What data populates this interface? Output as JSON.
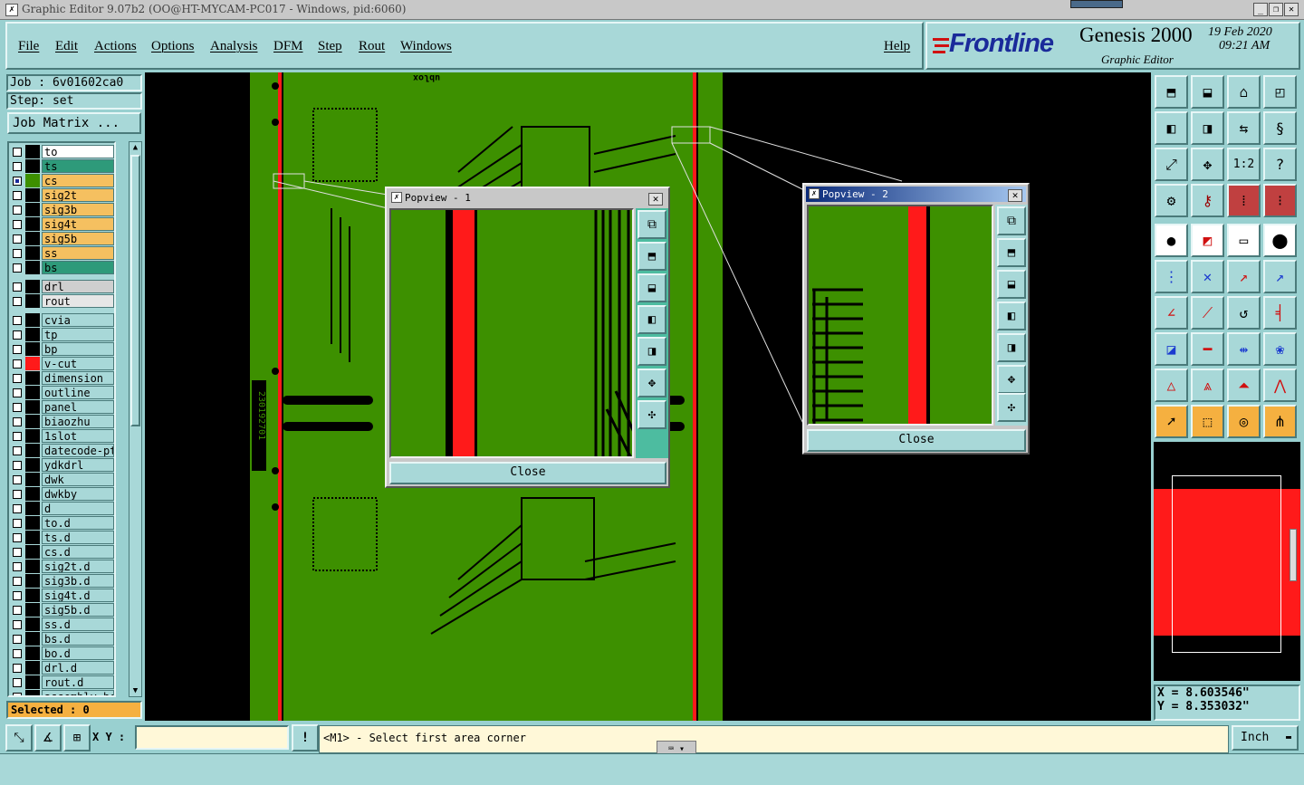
{
  "window": {
    "title": "Graphic Editor 9.07b2 (OO@HT-MYCAM-PC017 - Windows, pid:6060)",
    "minimize": "_",
    "restore": "❐",
    "close": "✕"
  },
  "menu": {
    "items": [
      "File",
      "Edit",
      "Actions",
      "Options",
      "Analysis",
      "DFM",
      "Step",
      "Rout",
      "Windows"
    ],
    "help": "Help"
  },
  "brand": {
    "logo": "Frontline",
    "product": "Genesis 2000",
    "subtitle": "Graphic Editor",
    "date": "19 Feb 2020",
    "time": "09:21 AM"
  },
  "job": {
    "job_label": "Job : 6v01602ca0",
    "step_label": "Step: set",
    "matrix_button": "Job Matrix ..."
  },
  "colors": {
    "yellow": "#f5c060",
    "teal": "#2e9a7a",
    "cyan": "#a8d8d8",
    "grey": "#cfcfcf",
    "white": "#ffffff",
    "board_green": "#3d9000",
    "copper_red": "#ff1a1a"
  },
  "layers": [
    {
      "name": "to",
      "bg": "#ffffff",
      "swatch": "#000000",
      "check": false
    },
    {
      "name": "ts",
      "bg": "#2e9a7a",
      "swatch": "#000000",
      "check": false
    },
    {
      "name": "cs",
      "bg": "#f5c060",
      "swatch": "#3d9000",
      "check": true
    },
    {
      "name": "sig2t",
      "bg": "#f5c060",
      "swatch": "#000000",
      "check": false
    },
    {
      "name": "sig3b",
      "bg": "#f5c060",
      "swatch": "#000000",
      "check": false
    },
    {
      "name": "sig4t",
      "bg": "#f5c060",
      "swatch": "#000000",
      "check": false
    },
    {
      "name": "sig5b",
      "bg": "#f5c060",
      "swatch": "#000000",
      "check": false
    },
    {
      "name": "ss",
      "bg": "#f5c060",
      "swatch": "#000000",
      "check": false
    },
    {
      "name": "bs",
      "bg": "#2e9a7a",
      "swatch": "#000000",
      "check": false
    },
    {
      "name": "drl",
      "bg": "#cfcfcf",
      "swatch": "#000000",
      "check": false,
      "gap": true
    },
    {
      "name": "rout",
      "bg": "#e6e6e6",
      "swatch": "#000000",
      "check": false
    },
    {
      "name": "cvia",
      "bg": "#a8d8d8",
      "swatch": "#000000",
      "check": false,
      "gap": true
    },
    {
      "name": "tp",
      "bg": "#a8d8d8",
      "swatch": "#000000",
      "check": false
    },
    {
      "name": "bp",
      "bg": "#a8d8d8",
      "swatch": "#000000",
      "check": false
    },
    {
      "name": "v-cut",
      "bg": "#a8d8d8",
      "swatch": "#ff1a1a",
      "check": false
    },
    {
      "name": "dimension",
      "bg": "#a8d8d8",
      "swatch": "#000000",
      "check": false
    },
    {
      "name": "outline",
      "bg": "#a8d8d8",
      "swatch": "#000000",
      "check": false
    },
    {
      "name": "panel",
      "bg": "#a8d8d8",
      "swatch": "#000000",
      "check": false
    },
    {
      "name": "biaozhu",
      "bg": "#a8d8d8",
      "swatch": "#000000",
      "check": false
    },
    {
      "name": "1slot",
      "bg": "#a8d8d8",
      "swatch": "#000000",
      "check": false
    },
    {
      "name": "datecode-pte",
      "bg": "#a8d8d8",
      "swatch": "#000000",
      "check": false
    },
    {
      "name": "ydkdrl",
      "bg": "#a8d8d8",
      "swatch": "#000000",
      "check": false
    },
    {
      "name": "dwk",
      "bg": "#a8d8d8",
      "swatch": "#000000",
      "check": false
    },
    {
      "name": "dwkby",
      "bg": "#a8d8d8",
      "swatch": "#000000",
      "check": false
    },
    {
      "name": "d",
      "bg": "#a8d8d8",
      "swatch": "#000000",
      "check": false
    },
    {
      "name": "to.d",
      "bg": "#a8d8d8",
      "swatch": "#000000",
      "check": false
    },
    {
      "name": "ts.d",
      "bg": "#a8d8d8",
      "swatch": "#000000",
      "check": false
    },
    {
      "name": "cs.d",
      "bg": "#a8d8d8",
      "swatch": "#000000",
      "check": false
    },
    {
      "name": "sig2t.d",
      "bg": "#a8d8d8",
      "swatch": "#000000",
      "check": false
    },
    {
      "name": "sig3b.d",
      "bg": "#a8d8d8",
      "swatch": "#000000",
      "check": false
    },
    {
      "name": "sig4t.d",
      "bg": "#a8d8d8",
      "swatch": "#000000",
      "check": false
    },
    {
      "name": "sig5b.d",
      "bg": "#a8d8d8",
      "swatch": "#000000",
      "check": false
    },
    {
      "name": "ss.d",
      "bg": "#a8d8d8",
      "swatch": "#000000",
      "check": false
    },
    {
      "name": "bs.d",
      "bg": "#a8d8d8",
      "swatch": "#000000",
      "check": false
    },
    {
      "name": "bo.d",
      "bg": "#a8d8d8",
      "swatch": "#000000",
      "check": false
    },
    {
      "name": "drl.d",
      "bg": "#a8d8d8",
      "swatch": "#000000",
      "check": false
    },
    {
      "name": "rout.d",
      "bg": "#a8d8d8",
      "swatch": "#000000",
      "check": false
    },
    {
      "name": "assembly-bot",
      "bg": "#a8d8d8",
      "swatch": "#000000",
      "check": false
    }
  ],
  "selected_label": "Selected : 0",
  "board": {
    "vertical_text": "230192701",
    "top_text": "ublox"
  },
  "popview1": {
    "title": "Popview - 1",
    "close": "Close"
  },
  "popview2": {
    "title": "Popview - 2",
    "close": "Close"
  },
  "popview_tools": [
    "zoom-fit-icon",
    "pan-up-icon",
    "pan-down-icon",
    "pan-left-icon",
    "pan-right-icon",
    "zoom-in-icon",
    "zoom-out-icon"
  ],
  "coords": {
    "x": "X = 8.603546\"",
    "y": "Y = 8.353032\""
  },
  "status": {
    "xy_label": "X Y :",
    "xy_value": "",
    "exclaim": "!",
    "prompt": "<M1> - Select first area corner",
    "units": "Inch"
  }
}
